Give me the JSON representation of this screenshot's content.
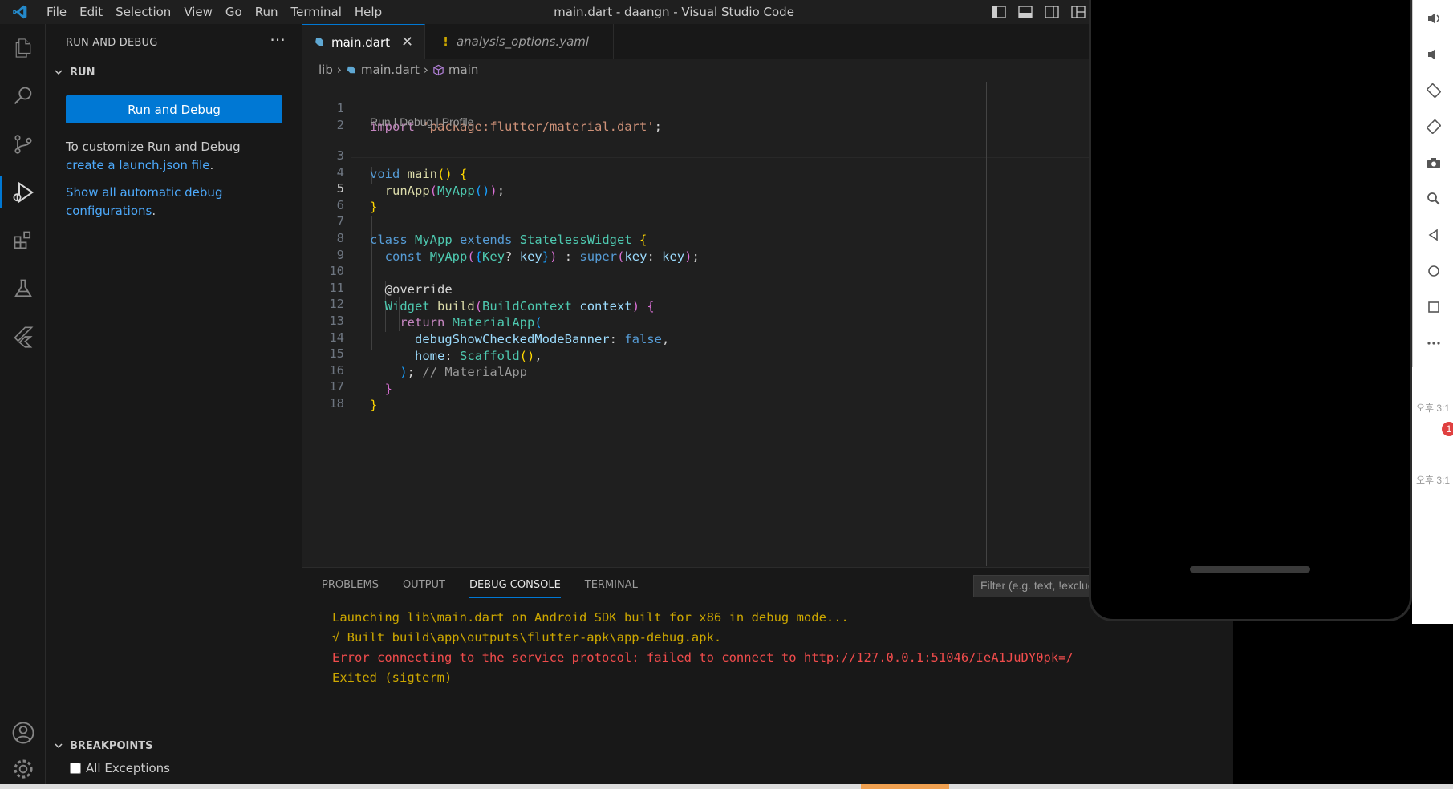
{
  "titlebar": {
    "menu": [
      "File",
      "Edit",
      "Selection",
      "View",
      "Go",
      "Run",
      "Terminal",
      "Help"
    ],
    "window_title": "main.dart - daangn - Visual Studio Code"
  },
  "sidebar": {
    "header": "RUN AND DEBUG",
    "section": "RUN",
    "run_button": "Run and Debug",
    "customize_prefix": "To customize Run and Debug ",
    "customize_link": "create a launch.json file",
    "customize_suffix": ".",
    "show_link": "Show all automatic debug configurations",
    "show_suffix": ".",
    "breakpoints_header": "BREAKPOINTS",
    "breakpoint_item": "All Exceptions"
  },
  "tabs": [
    {
      "label": "main.dart",
      "active": true
    },
    {
      "label": "analysis_options.yaml",
      "active": false
    }
  ],
  "breadcrumbs": [
    "lib",
    "main.dart",
    "main"
  ],
  "editor": {
    "codelens": "Run | Debug | Profile",
    "line_numbers": [
      "1",
      "2",
      "3",
      "4",
      "5",
      "6",
      "7",
      "8",
      "9",
      "10",
      "11",
      "12",
      "13",
      "14",
      "15",
      "16",
      "17",
      "18"
    ],
    "code": {
      "l1_kw": "import",
      "l1_str": "'package:flutter/material.dart'",
      "l1_end": ";",
      "l3_kw": "void",
      "l3_fn": "main",
      "l3_paren": "()",
      "l3_brace": "{",
      "l4_fn": "runApp",
      "l4_p1": "(",
      "l4_ty": "MyApp",
      "l4_p2": "()",
      "l4_p3": ")",
      "l4_end": ";",
      "l5_brace": "}",
      "l7_kw": "class",
      "l7_ty": "MyApp",
      "l7_kw2": "extends",
      "l7_ty2": "StatelessWidget",
      "l7_brace": "{",
      "l8_kw": "const",
      "l8_ty": "MyApp",
      "l8_p1": "(",
      "l8_b1": "{",
      "l8_ty2": "Key",
      "l8_q": "?",
      "l8_var": "key",
      "l8_b2": "}",
      "l8_p2": ")",
      "l8_colon": " : ",
      "l8_super": "super",
      "l8_p3": "(",
      "l8_named": "key",
      "l8_c2": ": ",
      "l8_var2": "key",
      "l8_p4": ")",
      "l8_end": ";",
      "l10_ann": "@override",
      "l11_ty": "Widget",
      "l11_fn": "build",
      "l11_p1": "(",
      "l11_ty2": "BuildContext",
      "l11_var": "context",
      "l11_p2": ")",
      "l11_brace": "{",
      "l12_kw": "return",
      "l12_ty": "MaterialApp",
      "l12_p": "(",
      "l13_named": "debugShowCheckedModeBanner",
      "l13_c": ": ",
      "l13_val": "false",
      "l13_end": ",",
      "l14_named": "home",
      "l14_c": ": ",
      "l14_ty": "Scaffold",
      "l14_p": "()",
      "l14_end": ",",
      "l15_p": ")",
      "l15_end": ";",
      "l15_cm": "// MaterialApp",
      "l16_brace": "}",
      "l17_brace": "}"
    }
  },
  "panel": {
    "tabs": [
      "PROBLEMS",
      "OUTPUT",
      "DEBUG CONSOLE",
      "TERMINAL"
    ],
    "active_tab": "DEBUG CONSOLE",
    "filter_placeholder": "Filter (e.g. text, !exclude)",
    "console": [
      "Launching lib\\main.dart on Android SDK built for x86 in debug mode...",
      "√  Built build\\app\\outputs\\flutter-apk\\app-debug.apk.",
      "Error connecting to the service protocol: failed to connect to http://127.0.0.1:51046/IeA1JuDY0pk=/",
      "Exited (sigterm)"
    ]
  },
  "right_side": {
    "time_1": "오후 3:1",
    "time_2": "오후 3:1",
    "badge": "1"
  },
  "colors": {
    "accent": "#0078d4",
    "error": "#f14c4c",
    "warning": "#cca700",
    "link": "#4daafc"
  }
}
